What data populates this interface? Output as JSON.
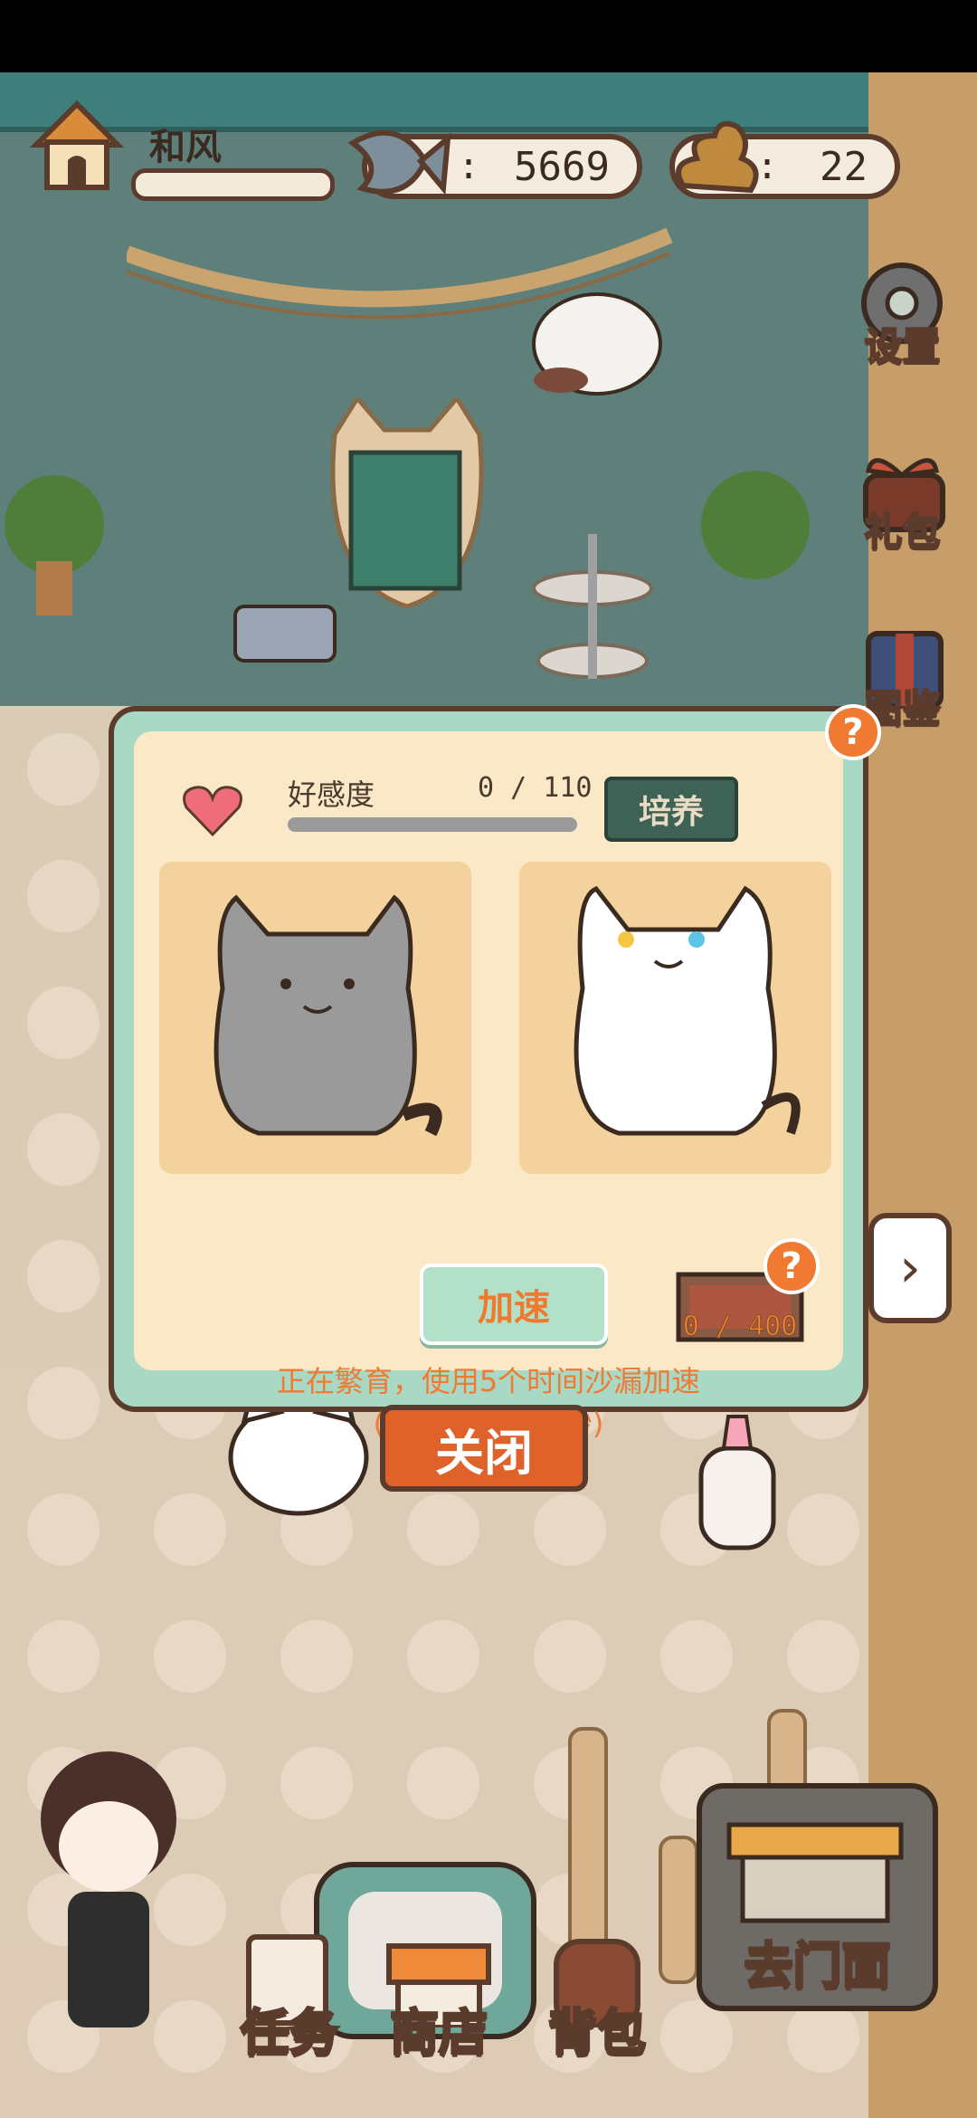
{
  "hud": {
    "player_name": "和风",
    "xp_progress": 0.0,
    "fish_coins": "5669",
    "fish_prefix": ":",
    "cat_litter": "22",
    "litter_prefix": ":"
  },
  "side_buttons": [
    {
      "label": "设置",
      "icon": "gear-icon"
    },
    {
      "label": "礼包",
      "icon": "gift-box-icon"
    },
    {
      "label": "图鉴",
      "icon": "book-icon"
    }
  ],
  "modal": {
    "affection_label": "好感度",
    "affection_value": "0 / 110",
    "affection_progress": 0.0,
    "train_button": "培养",
    "speed_button": "加速",
    "hourglass_count": "0 / 400",
    "status_text": "正在繁育，使用5个时间沙漏加速",
    "time_remaining": "(3小时59分50秒)",
    "help_badge": "?"
  },
  "close_button": "关闭",
  "next_arrow": "›",
  "bottom_nav": [
    {
      "label": "任务",
      "icon": "task-icon"
    },
    {
      "label": "商店",
      "icon": "shop-icon"
    },
    {
      "label": "背包",
      "icon": "backpack-icon"
    },
    {
      "label": "去门面",
      "icon": "storefront-icon"
    }
  ],
  "colors": {
    "accent_orange": "#f07a32",
    "outline_brown": "#5b3c2c",
    "modal_frame": "#a9d9c4",
    "modal_bg": "#fbe8c7"
  }
}
